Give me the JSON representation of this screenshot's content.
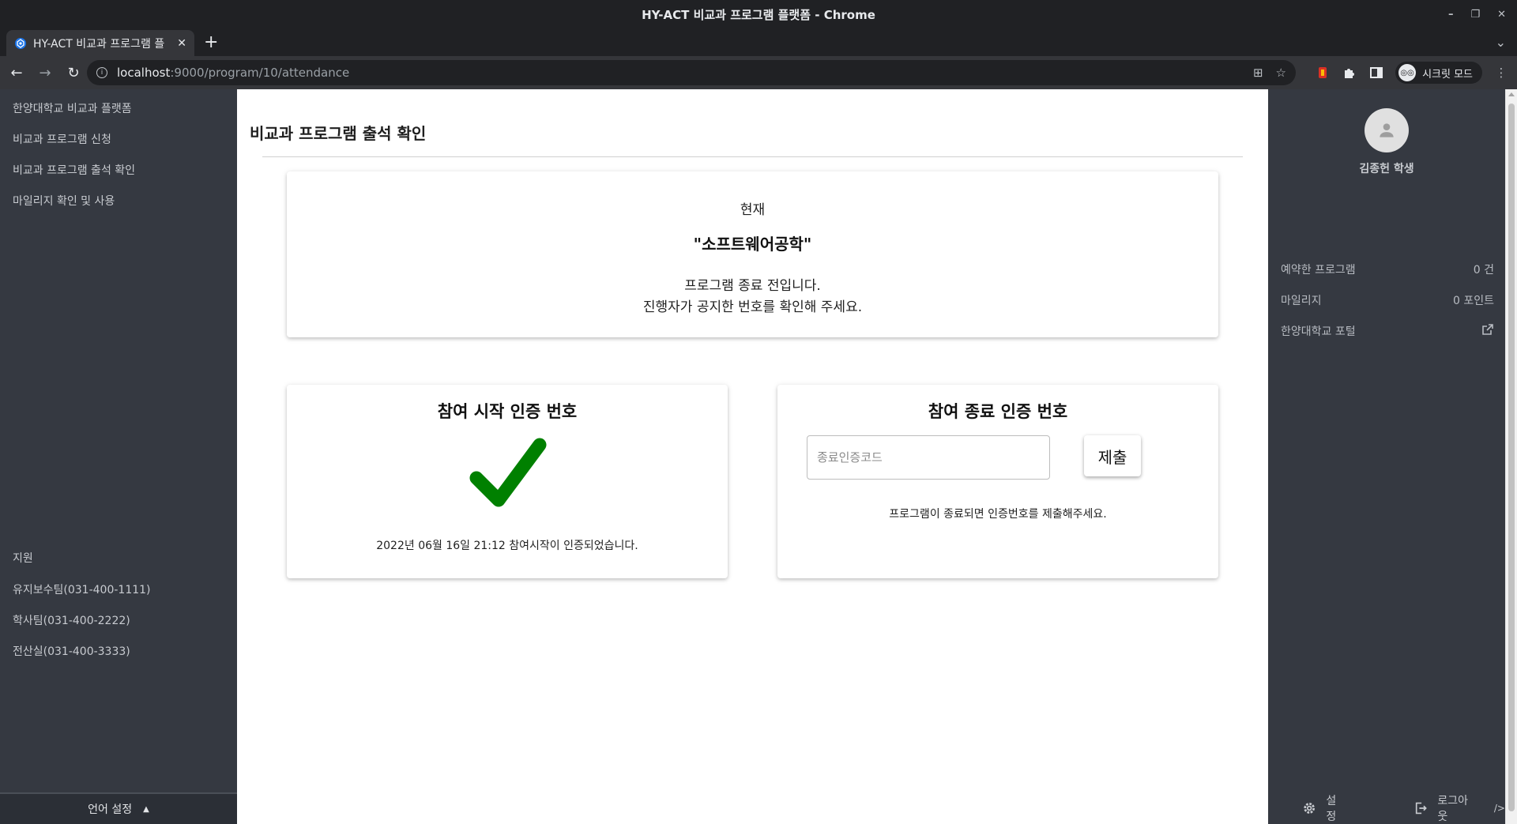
{
  "window": {
    "title": "HY-ACT 비교과 프로그램 플랫폼 - Chrome",
    "controls": [
      "–",
      "❐",
      "✕"
    ]
  },
  "tab": {
    "title": "HY-ACT 비교과 프로그램 플",
    "close": "✕"
  },
  "browser": {
    "new_tab": "+",
    "tab_list": "⌄",
    "back": "←",
    "forward": "→",
    "reload": "↻",
    "url_host": "localhost",
    "url_path": ":9000/program/10/attendance",
    "info": "i",
    "translate": "⊞",
    "bookmark": "☆",
    "incognito_label": "시크릿 모드",
    "incognito_icon": "◎◎",
    "menu": "⋮"
  },
  "left_nav": {
    "items": [
      "한양대학교 비교과 플랫폼",
      "비교과 프로그램 신청",
      "비교과 프로그램 출석 확인",
      "마일리지 확인 및 사용"
    ],
    "support_title": "지원",
    "support_items": [
      "유지보수팀(031-400-1111)",
      "학사팀(031-400-2222)",
      "전산실(031-400-3333)"
    ],
    "language": "언어 설정",
    "language_caret": "▲"
  },
  "main": {
    "title": "비교과 프로그램 출석 확인",
    "notice": {
      "current": "현재",
      "program": "\"소프트웨어공학\"",
      "message1": "프로그램 종료 전입니다.",
      "message2": "진행자가 공지한 번호를 확인해 주세요."
    },
    "start_card": {
      "title": "참여 시작 인증 번호",
      "message": "2022년 06월 16일 21:12 참여시작이 인증되었습니다.",
      "check_color": "#008000"
    },
    "end_card": {
      "title": "참여 종료 인증 번호",
      "input_value": "",
      "input_placeholder": "종료인증코드",
      "submit_label": "제출",
      "message": "프로그램이 종료되면 인증번호를 제출해주세요."
    }
  },
  "right_panel": {
    "user_name": "김종헌 학생",
    "stats": [
      {
        "label": "예약한 프로그램",
        "value": "0 건"
      },
      {
        "label": "마일리지",
        "value": "0 포인트"
      }
    ],
    "portal_label": "한양대학교 포털",
    "settings_label": "설정",
    "logout_label": "로그아웃",
    "collapse_label": "/>"
  },
  "colors": {
    "sidebar_bg": "#353941",
    "chrome_bg": "#202124",
    "toolbar_bg": "#35363a",
    "success_green": "#008000"
  }
}
